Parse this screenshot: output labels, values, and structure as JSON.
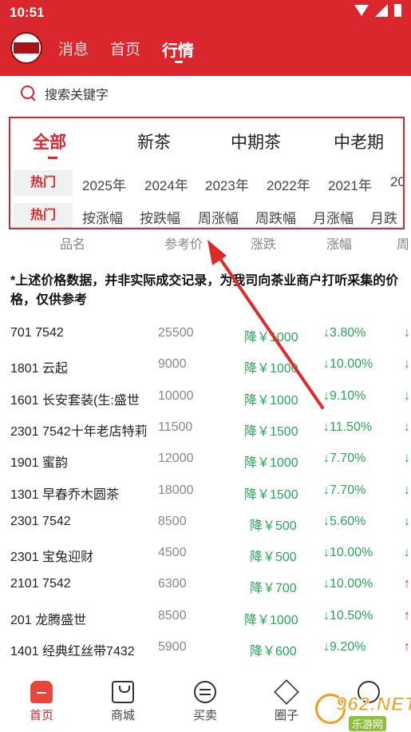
{
  "status_bar": {
    "time": "10:51"
  },
  "header": {
    "tabs": [
      {
        "label": "消息"
      },
      {
        "label": "首页"
      },
      {
        "label": "行情",
        "active": true
      }
    ]
  },
  "search": {
    "placeholder": "搜索关键字"
  },
  "categories": [
    "全部",
    "新茶",
    "中期茶",
    "中老期"
  ],
  "filters": {
    "hot_label": "热门",
    "years": [
      "2025年",
      "2024年",
      "2023年",
      "2022年",
      "2021年",
      "20"
    ],
    "sorts": [
      "按涨幅",
      "按跌幅",
      "周涨幅",
      "周跌幅",
      "月涨幅",
      "月跌"
    ]
  },
  "columns": [
    "品名",
    "参考价",
    "涨跌",
    "涨幅",
    "周"
  ],
  "notice": "*上述价格数据，并非实际成交记录，为我司向茶业商户打听采集的价格，仅供参考",
  "rows": [
    {
      "name": "701 7542",
      "price": "25500",
      "change": "降￥1000",
      "pct": "↓3.80%",
      "edge": "↓"
    },
    {
      "name": "1801 云起",
      "price": "9000",
      "change": "降￥1000",
      "pct": "↓10.00%",
      "edge": "↓"
    },
    {
      "name": "1601 长安套装(生:盛世",
      "price": "10000",
      "change": "降￥1000",
      "pct": "↓9.10%",
      "edge": "↓"
    },
    {
      "name": "2301 7542十年老店特莉",
      "price": "11500",
      "change": "降￥1500",
      "pct": "↓11.50%",
      "edge": "↓"
    },
    {
      "name": "1901 蜜韵",
      "price": "12000",
      "change": "降￥1000",
      "pct": "↓7.70%",
      "edge": "↓"
    },
    {
      "name": "1301 早春乔木圆茶",
      "price": "18000",
      "change": "降￥1500",
      "pct": "↓7.70%",
      "edge": "↓"
    },
    {
      "name": "2301 7542",
      "price": "8500",
      "change": "降￥500",
      "pct": "↓5.60%",
      "edge": "↓"
    },
    {
      "name": "2301 宝兔迎财",
      "price": "4500",
      "change": "降￥500",
      "pct": "↓10.00%",
      "edge": "↓"
    },
    {
      "name": "2101 7542",
      "price": "6300",
      "change": "降￥700",
      "pct": "↓10.00%",
      "edge": "↑"
    },
    {
      "name": "201 龙腾盛世",
      "price": "8500",
      "change": "降￥1000",
      "pct": "↓10.50%",
      "edge": "↑"
    },
    {
      "name": "1401 经典红丝带7432",
      "price": "5900",
      "change": "降￥600",
      "pct": "↓9.20%",
      "edge": "↑"
    }
  ],
  "bottom_nav": [
    {
      "label": "首页",
      "icon": "home-icon",
      "active": true
    },
    {
      "label": "商城",
      "icon": "shopping-bag-icon"
    },
    {
      "label": "买卖",
      "icon": "trade-icon"
    },
    {
      "label": "圈子",
      "icon": "circle-icon"
    },
    {
      "label": "",
      "icon": "profile-icon"
    }
  ],
  "watermark": {
    "text": "962.NET",
    "subtext": "乐游网"
  },
  "colors": {
    "brand": "#d9272d",
    "down": "#2aa55a",
    "up": "#d9272d"
  }
}
